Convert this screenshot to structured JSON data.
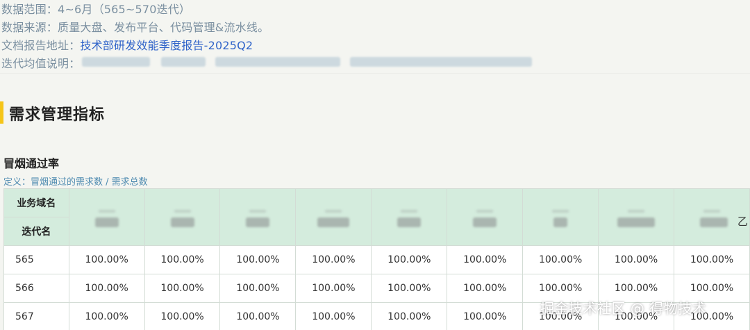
{
  "meta": {
    "range_line": "数据范围：4~6月（565~570迭代）",
    "source_line": "数据来源：质量大盘、发布平台、代码管理&流水线。",
    "doc_label": "文档报告地址：",
    "doc_link": "技术部研发效能季度报告-2025Q2",
    "avg_label": "迭代均值说明："
  },
  "section": {
    "title": "需求管理指标"
  },
  "metric": {
    "title": "冒烟通过率",
    "definition": "定义：冒烟通过的需求数 / 需求总数"
  },
  "table": {
    "corner_top": "业务域名",
    "corner_bottom": "迭代名",
    "edge_glyph": "乙",
    "rows": [
      {
        "iteration": "565",
        "values": [
          "100.00%",
          "100.00%",
          "100.00%",
          "100.00%",
          "100.00%",
          "100.00%",
          "100.00%",
          "100.00%",
          "100.00%"
        ]
      },
      {
        "iteration": "566",
        "values": [
          "100.00%",
          "100.00%",
          "100.00%",
          "100.00%",
          "100.00%",
          "100.00%",
          "100.00%",
          "100.00%",
          "100.00%"
        ]
      },
      {
        "iteration": "567",
        "values": [
          "100.00%",
          "100.00%",
          "100.00%",
          "100.00%",
          "100.00%",
          "100.00%",
          "100.00%",
          "100.00%",
          "100.00%"
        ]
      }
    ]
  },
  "watermark": "掘金技术社区 @ 得物技术"
}
